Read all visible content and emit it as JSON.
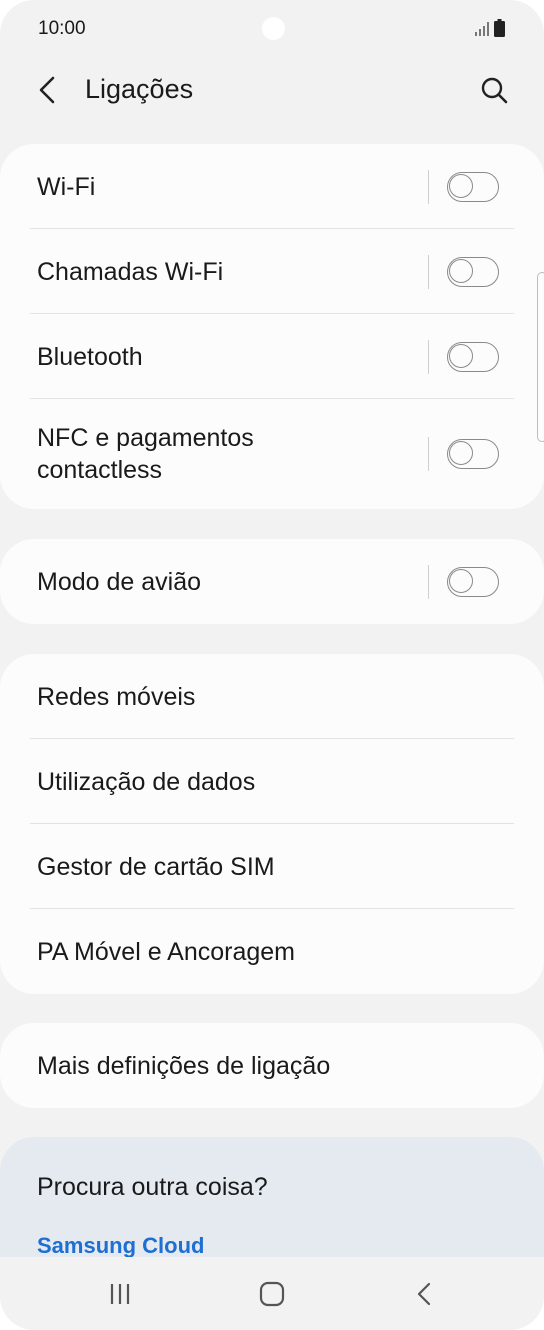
{
  "status_bar": {
    "time": "10:00"
  },
  "header": {
    "title": "Ligações",
    "back_icon": "chevron-left-icon",
    "search_icon": "search-icon"
  },
  "sections": {
    "wireless": [
      {
        "label": "Wi-Fi",
        "toggle": false
      },
      {
        "label": "Chamadas Wi-Fi",
        "toggle": false
      },
      {
        "label": "Bluetooth",
        "toggle": false
      },
      {
        "label": "NFC e pagamentos contactless",
        "toggle": false
      }
    ],
    "airplane": {
      "label": "Modo de avião",
      "toggle": false
    },
    "network": [
      {
        "label": "Redes móveis"
      },
      {
        "label": "Utilização de dados"
      },
      {
        "label": "Gestor de cartão SIM"
      },
      {
        "label": "PA Móvel e Ancoragem"
      }
    ],
    "more": {
      "label": "Mais definições de ligação"
    }
  },
  "suggestions": {
    "title": "Procura outra coisa?",
    "link": "Samsung Cloud"
  },
  "colors": {
    "background": "#f2f2f2",
    "card": "#fcfcfc",
    "suggest_card": "#e5eaf1",
    "link": "#1d6fd1"
  },
  "nav": {
    "recent_icon": "recent-apps-icon",
    "home_icon": "home-icon",
    "back_icon": "back-icon"
  }
}
